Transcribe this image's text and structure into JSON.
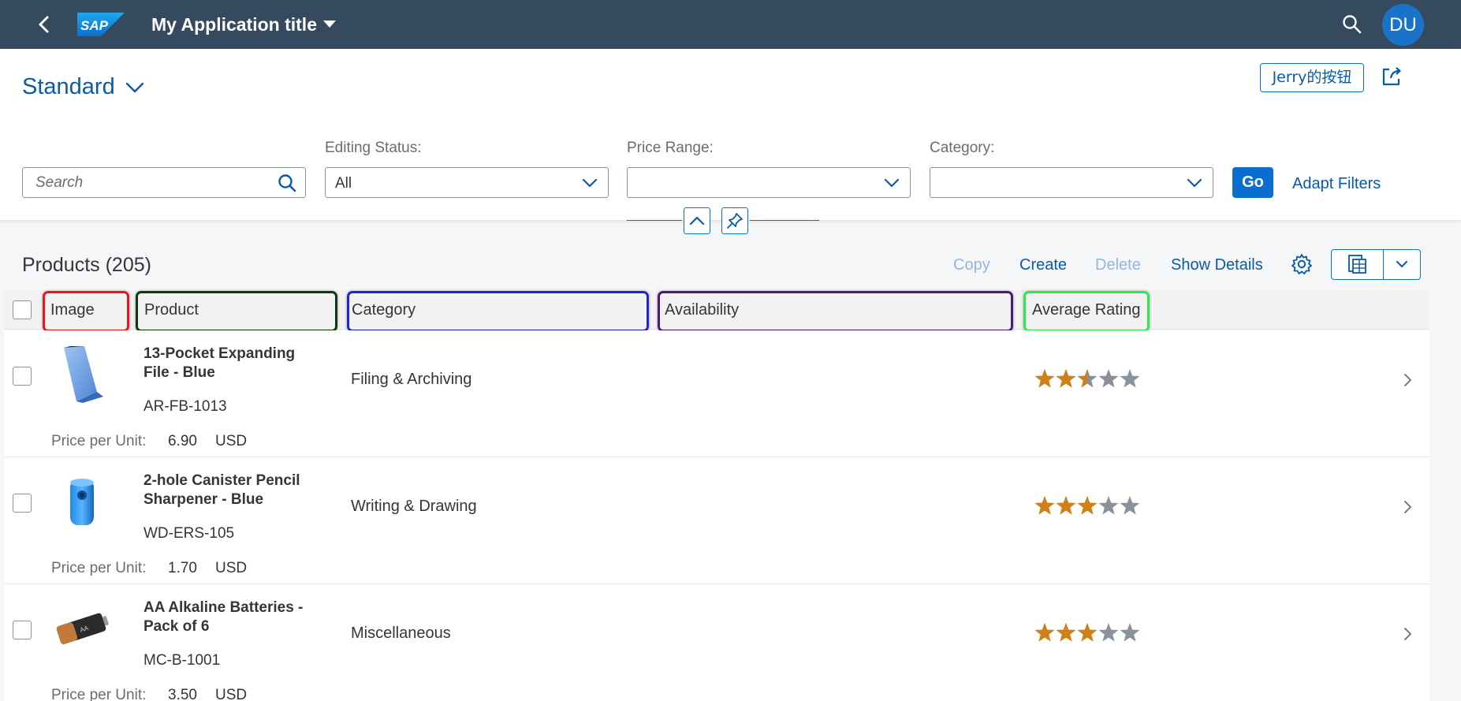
{
  "shell": {
    "logo_text": "SAP",
    "title": "My Application title",
    "avatar_initials": "DU"
  },
  "header": {
    "variant": "Standard",
    "custom_button": "Jerry的按钮",
    "search_placeholder": "Search",
    "filters": [
      {
        "label": "Editing Status:",
        "value": "All"
      },
      {
        "label": "Price Range:",
        "value": ""
      },
      {
        "label": "Category:",
        "value": ""
      }
    ],
    "go_label": "Go",
    "adapt_label": "Adapt Filters"
  },
  "table": {
    "title": "Products (205)",
    "toolbar": {
      "copy": "Copy",
      "create": "Create",
      "delete": "Delete",
      "show_details": "Show Details"
    },
    "columns": [
      "Image",
      "Product",
      "Category",
      "Availability",
      "Average Rating"
    ],
    "highlight_colors": [
      "#e8151a",
      "#123a12",
      "#1f24d6",
      "#4a1a7a",
      "#2fe84a"
    ],
    "rows": [
      {
        "name": "13-Pocket Expanding File - Blue",
        "id": "AR-FB-1013",
        "category": "Filing & Archiving",
        "rating": 2.5,
        "price_label": "Price per Unit:",
        "price": "6.90",
        "currency": "USD",
        "image": "file-icon"
      },
      {
        "name": "2-hole Canister Pencil Sharpener - Blue",
        "id": "WD-ERS-105",
        "category": "Writing & Drawing",
        "rating": 3,
        "price_label": "Price per Unit:",
        "price": "1.70",
        "currency": "USD",
        "image": "sharpener-icon"
      },
      {
        "name": "AA Alkaline Batteries - Pack of 6",
        "id": "MC-B-1001",
        "category": "Miscellaneous",
        "rating": 3,
        "price_label": "Price per Unit:",
        "price": "3.50",
        "currency": "USD",
        "image": "battery-icon"
      }
    ]
  },
  "colors": {
    "shell": "#354a5f",
    "link": "#0a5aa8",
    "emphasized": "#0a6ed1",
    "star_filled": "#d08014",
    "star_empty": "#89919a"
  }
}
